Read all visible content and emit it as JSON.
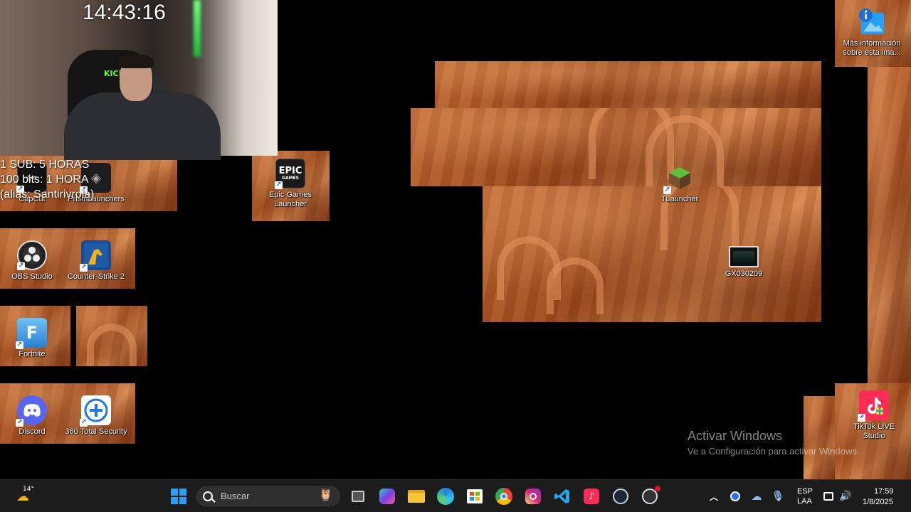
{
  "webcam": {
    "clock": "14:43:16",
    "chair_brand": "KICK"
  },
  "overlay": {
    "lines": [
      "1 SUB: 5 HORAS",
      "100 bits: 1 HORA",
      "(alias: Santirivrola)"
    ]
  },
  "desktop": {
    "icons": {
      "capcut": "CapCut",
      "prismlaunchers": "PrismLaunchers",
      "epic": "Epic Games Launcher",
      "epic_logo": "EPIC",
      "epic_logo_sub": "GAMES",
      "obs": "OBS Studio",
      "cs2": "Counter-Strike 2",
      "fortnite": "Fortnite",
      "discord": "Discord",
      "total_security": "360 Total Security",
      "tlauncher": "TLauncher",
      "gx": "GX030209",
      "info": "Más información sobre esta ima...",
      "tiktok_live": "TikTok LIVE Studio"
    }
  },
  "watermark": {
    "title": "Activar Windows",
    "subtitle": "Ve a Configuración para activar Windows."
  },
  "taskbar": {
    "weather_temp": "14°",
    "search_placeholder": "Buscar",
    "language": "ESP",
    "language_sub": "LAA",
    "time": "17:59",
    "date": "1/8/2025"
  },
  "colors": {
    "taskbar_bg": "#1c1c1c",
    "discord": "#5865f2",
    "windows_blue": "#2a9df4"
  }
}
